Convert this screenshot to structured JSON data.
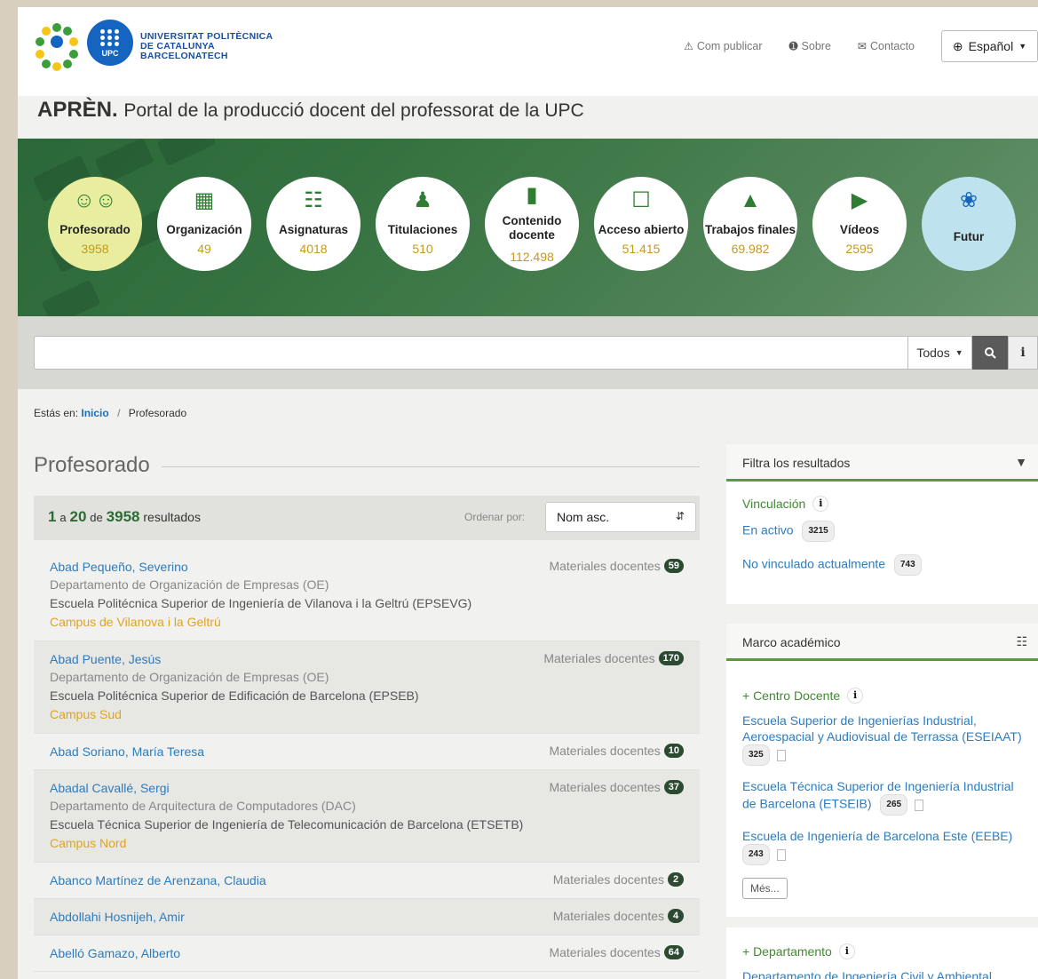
{
  "header": {
    "logo_text": [
      "UNIVERSITAT POLITÈCNICA",
      "DE CATALUNYA",
      "BARCELONATECH"
    ],
    "logo_upc": "UPC",
    "links": [
      {
        "label": "Com publicar",
        "icon": "warning-icon"
      },
      {
        "label": "Sobre",
        "icon": "info-circle-icon"
      },
      {
        "label": "Contacto",
        "icon": "envelope-icon"
      }
    ],
    "language": "Español",
    "site_name": "APRÈN.",
    "site_subtitle": "Portal de la producció docent del professorat de la UPC"
  },
  "categories": [
    {
      "label": "Profesorado",
      "value": "3958",
      "icon": "people-icon",
      "active": true
    },
    {
      "label": "Organización",
      "value": "49",
      "icon": "building-icon"
    },
    {
      "label": "Asignaturas",
      "value": "4018",
      "icon": "hierarchy-icon"
    },
    {
      "label": "Titulaciones",
      "value": "510",
      "icon": "graduate-icon"
    },
    {
      "label": "Contenido docente",
      "value": "112.498",
      "icon": "document-icon"
    },
    {
      "label": "Acceso abierto",
      "value": "51.415",
      "icon": "unlock-icon"
    },
    {
      "label": "Trabajos finales",
      "value": "69.982",
      "icon": "mortarboard-icon"
    },
    {
      "label": "Vídeos",
      "value": "2595",
      "icon": "video-icon"
    },
    {
      "label": "Futur",
      "value": "",
      "icon": "upc-dots-icon"
    }
  ],
  "search": {
    "value": "",
    "scope": "Todos"
  },
  "breadcrumb": {
    "prefix": "Estás en:",
    "home": "Inicio",
    "current": "Profesorado"
  },
  "main": {
    "title": "Profesorado",
    "results_from": "1",
    "results_a": "a",
    "results_to": "20",
    "results_de": "de",
    "results_total": "3958",
    "results_label": "resultados",
    "order_label": "Ordenar por:",
    "order_value": "Nom asc."
  },
  "items": [
    {
      "name": "Abad Pequeño, Severino",
      "dept": "Departamento de Organización de Empresas (OE)",
      "school": "Escuela Politécnica Superior de Ingeniería de Vilanova i la Geltrú (EPSEVG)",
      "campus": "Campus de Vilanova i la Geltrú",
      "mat_label": "Materiales docentes",
      "mat_count": "59"
    },
    {
      "name": "Abad Puente, Jesús",
      "dept": "Departamento de Organización de Empresas (OE)",
      "school": "Escuela Politécnica Superior de Edificación de Barcelona (EPSEB)",
      "campus": "Campus Sud",
      "mat_label": "Materiales docentes",
      "mat_count": "170"
    },
    {
      "name": "Abad Soriano, María Teresa",
      "dept": "",
      "school": "",
      "campus": "",
      "mat_label": "Materiales docentes",
      "mat_count": "10"
    },
    {
      "name": "Abadal Cavallé, Sergi",
      "dept": "Departamento de Arquitectura de Computadores (DAC)",
      "school": "Escuela Técnica Superior de Ingeniería de Telecomunicación de Barcelona (ETSETB)",
      "campus": "Campus Nord",
      "mat_label": "Materiales docentes",
      "mat_count": "37"
    },
    {
      "name": "Abanco Martínez de Arenzana, Claudia",
      "dept": "",
      "school": "",
      "campus": "",
      "mat_label": "Materiales docentes",
      "mat_count": "2"
    },
    {
      "name": "Abdollahi Hosnijeh, Amir",
      "dept": "",
      "school": "",
      "campus": "",
      "mat_label": "Materiales docentes",
      "mat_count": "4"
    },
    {
      "name": "Abelló Gamazo, Alberto",
      "dept": "",
      "school": "",
      "campus": "",
      "mat_label": "Materiales docentes",
      "mat_count": "64"
    }
  ],
  "sidebar": {
    "filter_title": "Filtra los resultados",
    "vinculacion": {
      "title": "Vinculación",
      "options": [
        {
          "label": "En activo",
          "count": "3215"
        },
        {
          "label": "No vinculado actualmente",
          "count": "743"
        }
      ]
    },
    "marco_title": "Marco académico",
    "centro": {
      "title": "+ Centro Docente",
      "options": [
        {
          "label": "Escuela Superior de Ingenierías Industrial, Aeroespacial y Audiovisual de Terrassa (ESEIAAT)",
          "count": "325"
        },
        {
          "label": "Escuela Técnica Superior de Ingeniería Industrial de Barcelona (ETSEIB)",
          "count": "265"
        },
        {
          "label": "Escuela de Ingeniería de Barcelona Este (EEBE)",
          "count": "243"
        }
      ],
      "more": "Més..."
    },
    "departamento": {
      "title": "+ Departamento",
      "first_option": "Departamento de Ingeniería Civil y Ambiental"
    }
  },
  "colors": {
    "accent_green": "#3f8a2f",
    "link_blue": "#2d7cbf",
    "campus_gold": "#e0a420",
    "logo_blue": "#1a4fa0"
  }
}
